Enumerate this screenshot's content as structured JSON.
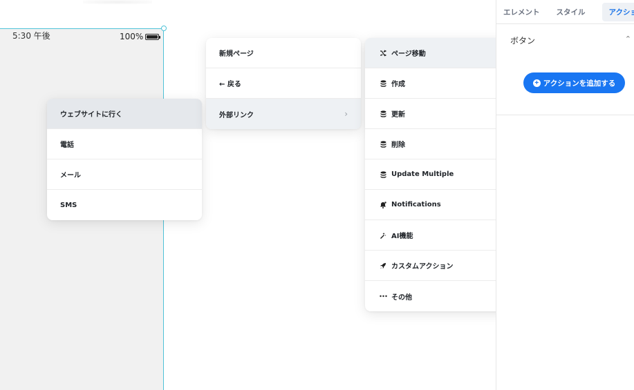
{
  "phone": {
    "time": "5:30 午後",
    "battery": "100%"
  },
  "menu_left": {
    "items": [
      {
        "label": "ウェブサイトに行く"
      },
      {
        "label": "電話"
      },
      {
        "label": "メール"
      },
      {
        "label": "SMS"
      }
    ]
  },
  "menu_mid": {
    "items": [
      {
        "label": "新規ページ"
      },
      {
        "label": "← 戻る"
      },
      {
        "label": "外部リンク"
      }
    ]
  },
  "menu_right": {
    "items": [
      {
        "label": "ページ移動",
        "icon": "shuffle-icon"
      },
      {
        "label": "作成",
        "icon": "database-icon"
      },
      {
        "label": "更新",
        "icon": "database-icon"
      },
      {
        "label": "削除",
        "icon": "database-icon"
      },
      {
        "label": "Update Multiple",
        "icon": "database-icon"
      },
      {
        "label": "Notifications",
        "icon": "bell-icon"
      },
      {
        "label": "AI機能",
        "icon": "wand-icon"
      },
      {
        "label": "カスタムアクション",
        "icon": "rocket-icon"
      },
      {
        "label": "その他",
        "icon": "more-icon"
      }
    ]
  },
  "panel": {
    "tabs": [
      "エレメント",
      "スタイル",
      "アクション"
    ],
    "section_title": "ボタン",
    "add_button": "アクションを追加する"
  },
  "colors": {
    "accent": "#1976f2",
    "frame": "#4fc3d8"
  }
}
